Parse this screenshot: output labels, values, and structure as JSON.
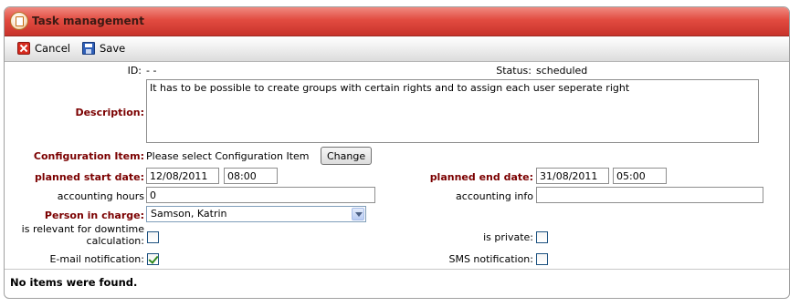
{
  "window": {
    "title": "Task management"
  },
  "toolbar": {
    "cancel_label": "Cancel",
    "save_label": "Save"
  },
  "form": {
    "id_label": "ID:",
    "id_value": "- -",
    "status_label": "Status:",
    "status_value": "scheduled",
    "description_label": "Description:",
    "description_value": "It has to be possible to create groups with certain rights and to assign each user seperate right",
    "ci_label": "Configuration Item:",
    "ci_value": "Please select Configuration Item",
    "change_label": "Change",
    "planned_start_label": "planned start date:",
    "planned_start_date": "12/08/2011",
    "planned_start_time": "08:00",
    "planned_end_label": "planned end date:",
    "planned_end_date": "31/08/2011",
    "planned_end_time": "05:00",
    "accounting_hours_label": "accounting hours",
    "accounting_hours_value": "0",
    "accounting_info_label": "accounting info",
    "accounting_info_value": "",
    "person_label": "Person in charge:",
    "person_value": "Samson, Katrin",
    "downtime_label_line1": "is relevant for downtime",
    "downtime_label_line2": "calculation:",
    "downtime_checked": false,
    "private_label": "is private:",
    "private_checked": false,
    "email_label": "E-mail notification:",
    "email_checked": true,
    "sms_label": "SMS notification:",
    "sms_checked": false
  },
  "footer": {
    "empty_text": "No items were found."
  }
}
